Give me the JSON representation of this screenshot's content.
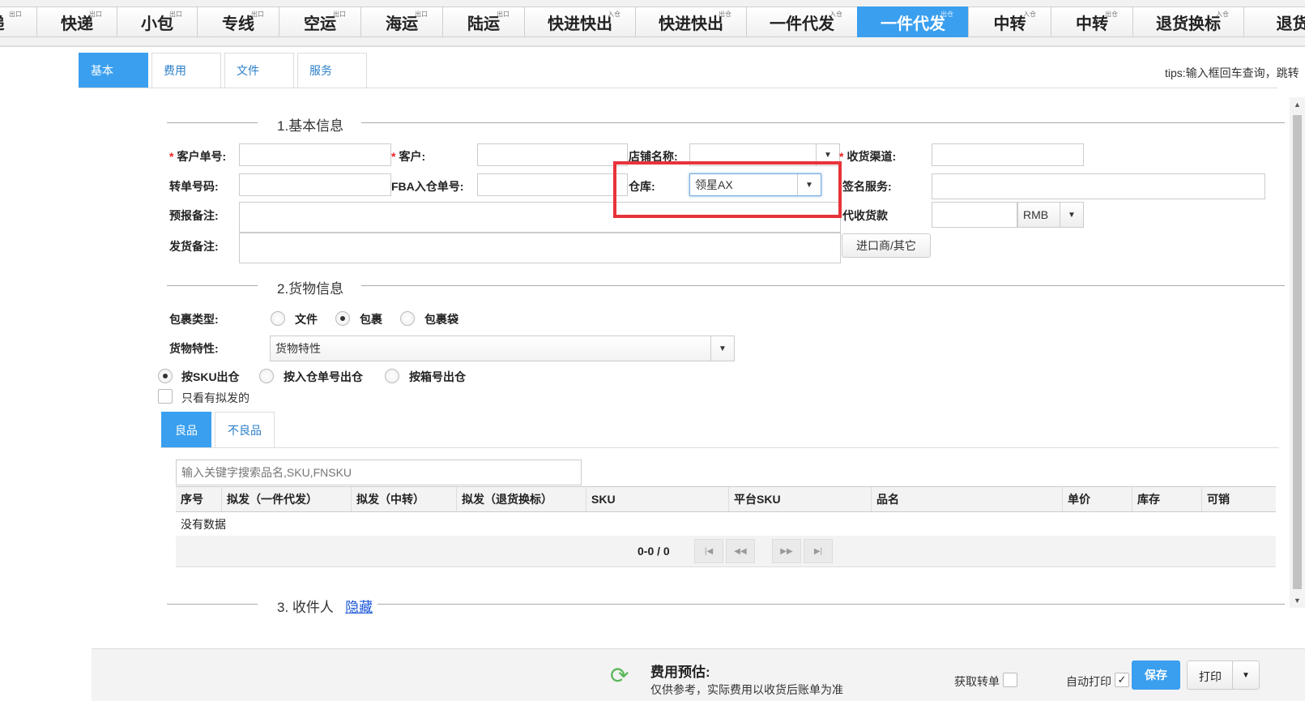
{
  "top_tabs": [
    {
      "label": "递",
      "sup": "出口"
    },
    {
      "label": "快递",
      "sup": "出口"
    },
    {
      "label": "小包",
      "sup": "出口"
    },
    {
      "label": "专线",
      "sup": "出口"
    },
    {
      "label": "空运",
      "sup": "出口"
    },
    {
      "label": "海运",
      "sup": "出口"
    },
    {
      "label": "陆运",
      "sup": "出口"
    },
    {
      "label": "快进快出",
      "sup": "入仓"
    },
    {
      "label": "快进快出",
      "sup": "出仓"
    },
    {
      "label": "一件代发",
      "sup": "入仓"
    },
    {
      "label": "一件代发",
      "sup": "出仓"
    },
    {
      "label": "中转",
      "sup": "入仓"
    },
    {
      "label": "中转",
      "sup": "出仓"
    },
    {
      "label": "退货换标",
      "sup": "入仓"
    },
    {
      "label": "退货",
      "sup": ""
    }
  ],
  "sub_tabs": [
    "基本",
    "费用",
    "文件",
    "服务"
  ],
  "tips": "tips:输入框回车查询，跳转",
  "sections": {
    "basic": "1.基本信息",
    "goods": "2.货物信息",
    "receiver": "3. 收件人",
    "receiver_toggle": "隐藏"
  },
  "form": {
    "customer_no_label": "客户单号:",
    "customer_label": "客户:",
    "shop_label": "店铺名称:",
    "channel_label": "收货渠道:",
    "transfer_no_label": "转单号码:",
    "fba_label": "FBA入仓单号:",
    "warehouse_label": "仓库:",
    "warehouse_value": "领星AX",
    "sign_label": "签名服务:",
    "pre_note_label": "预报备注:",
    "cod_label": "代收货款",
    "currency": "RMB",
    "ship_note_label": "发货备注:",
    "importer_button": "进口商/其它"
  },
  "goods": {
    "pkg_type_label": "包裹类型:",
    "pkg_types": [
      "文件",
      "包裹",
      "包裹袋"
    ],
    "nature_label": "货物特性:",
    "nature_placeholder": "货物特性",
    "outbound_modes": [
      "按SKU出仓",
      "按入仓单号出仓",
      "按箱号出仓"
    ],
    "only_planned": "只看有拟发的",
    "tabs": [
      "良品",
      "不良品"
    ],
    "search_placeholder": "输入关键字搜索品名,SKU,FNSKU",
    "columns": [
      "序号",
      "拟发（一件代发）",
      "拟发（中转）",
      "拟发（退货换标）",
      "SKU",
      "平台SKU",
      "品名",
      "单价",
      "库存",
      "可销"
    ],
    "empty_text": "没有数据",
    "pager_info": "0-0 / 0"
  },
  "footer": {
    "estimate_title": "费用预估:",
    "estimate_sub": "仅供参考，实际费用以收货后账单为准",
    "get_transfer": "获取转单",
    "auto_print": "自动打印",
    "save": "保存",
    "print": "打印"
  },
  "colors": {
    "accent": "#3a9fef",
    "highlight": "#e8333a",
    "refresh": "#5cb85c"
  }
}
